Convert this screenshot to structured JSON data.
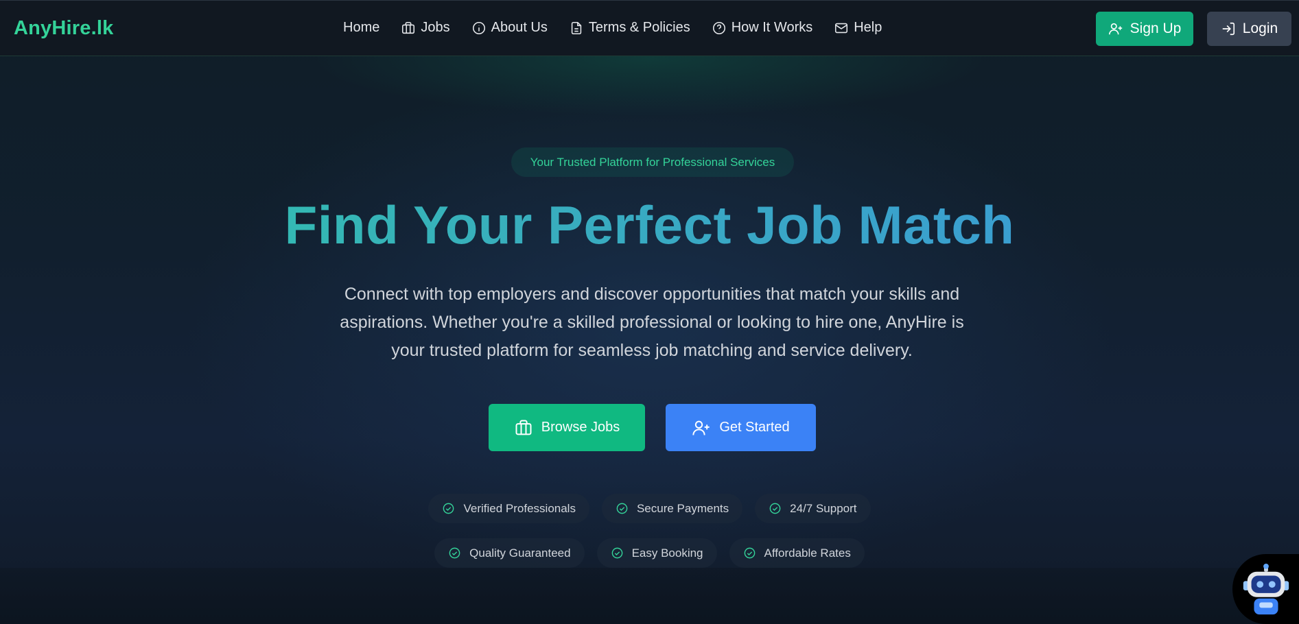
{
  "brand": {
    "name": "AnyHire.lk"
  },
  "nav": {
    "links": [
      {
        "label": "Home",
        "icon": "none"
      },
      {
        "label": "Jobs",
        "icon": "briefcase-icon"
      },
      {
        "label": "About Us",
        "icon": "info-icon"
      },
      {
        "label": "Terms & Policies",
        "icon": "document-icon"
      },
      {
        "label": "How It Works",
        "icon": "help-circle-icon"
      },
      {
        "label": "Help",
        "icon": "mail-icon"
      }
    ],
    "signup_label": "Sign Up",
    "login_label": "Login"
  },
  "hero": {
    "tagline": "Your Trusted Platform for Professional Services",
    "title": "Find Your Perfect Job Match",
    "description": "Connect with top employers and discover opportunities that match your skills and aspirations. Whether you're a skilled professional or looking to hire one, AnyHire is your trusted platform for seamless job matching and service delivery.",
    "browse_label": "Browse Jobs",
    "start_label": "Get Started"
  },
  "features": {
    "row1": [
      "Verified Professionals",
      "Secure Payments",
      "24/7 Support"
    ],
    "row2": [
      "Quality Guaranteed",
      "Easy Booking",
      "Affordable Rates"
    ]
  },
  "colors": {
    "accent_green": "#10b981",
    "brand_green": "#34d399",
    "accent_blue": "#3b82f6",
    "nav_bg": "#111821"
  }
}
